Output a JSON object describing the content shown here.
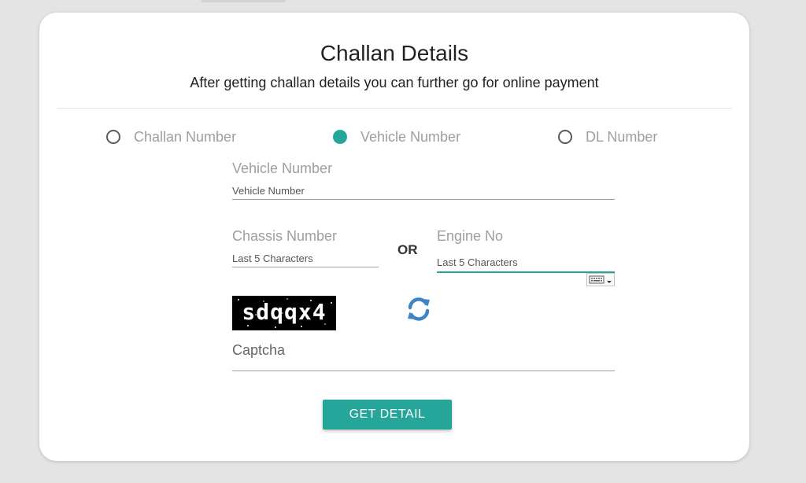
{
  "page": {
    "title": "Challan Details",
    "subtitle": "After getting challan details you can further go for online payment"
  },
  "search_by": {
    "selected": "Vehicle Number",
    "options": [
      {
        "label": "Challan Number",
        "checked": false
      },
      {
        "label": "Vehicle Number",
        "checked": true
      },
      {
        "label": "DL Number",
        "checked": false
      }
    ]
  },
  "vehicle_number": {
    "label": "Vehicle Number",
    "placeholder": "Vehicle Number",
    "value": ""
  },
  "chassis_number": {
    "label": "Chassis Number",
    "placeholder": "Last 5 Characters",
    "value": ""
  },
  "separator_text": "OR",
  "engine_no": {
    "label": "Engine No",
    "placeholder": "Last 5 Characters",
    "value": ""
  },
  "captcha": {
    "image_text": "sdqqx4",
    "label": "Captcha",
    "value": ""
  },
  "submit": {
    "label": "GET DETAIL"
  },
  "colors": {
    "accent": "#26a69a",
    "refresh_icon": "#3f83c9",
    "page_background": "#e4e4e4",
    "card_background": "#ffffff"
  },
  "icons": {
    "refresh": "refresh-icon",
    "keyboard": "keyboard-icon"
  }
}
